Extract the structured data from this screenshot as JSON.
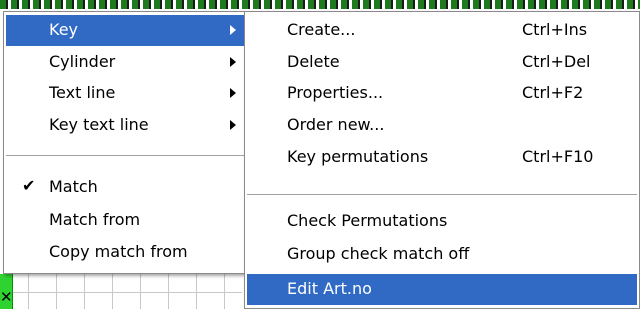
{
  "main_menu": {
    "items": [
      {
        "label": "Key",
        "submenu": true,
        "highlighted": true
      },
      {
        "label": "Cylinder",
        "submenu": true
      },
      {
        "label": "Text line",
        "submenu": true
      },
      {
        "label": "Key text line",
        "submenu": true
      },
      {
        "label": "Match",
        "checked": true
      },
      {
        "label": "Match from"
      },
      {
        "label": "Copy match from"
      }
    ],
    "check_glyph": "✔"
  },
  "key_submenu": {
    "items": [
      {
        "label": "Create...",
        "shortcut": "Ctrl+Ins"
      },
      {
        "label": "Delete",
        "shortcut": "Ctrl+Del"
      },
      {
        "label": "Properties...",
        "shortcut": "Ctrl+F2"
      },
      {
        "label": "Order new...",
        "shortcut": ""
      },
      {
        "label": "Key permutations",
        "shortcut": "Ctrl+F10"
      },
      {
        "label": "Check Permutations",
        "shortcut": ""
      },
      {
        "label": "Group check match off",
        "shortcut": ""
      },
      {
        "label": "Edit Art.no",
        "shortcut": "",
        "highlighted": true
      }
    ]
  },
  "colors": {
    "highlight": "#316ac5",
    "grid_green": "#2fd32f"
  }
}
